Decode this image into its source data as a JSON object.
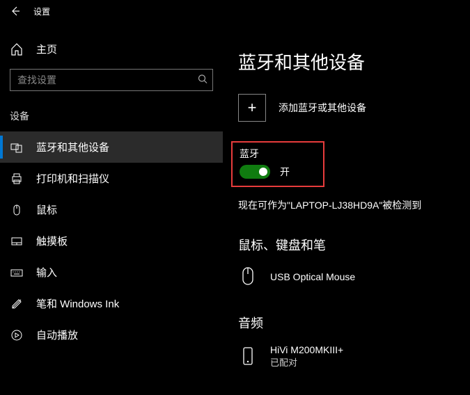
{
  "header": {
    "title": "设置"
  },
  "sidebar": {
    "home_label": "主页",
    "search_placeholder": "查找设置",
    "category_label": "设备",
    "items": [
      {
        "label": "蓝牙和其他设备"
      },
      {
        "label": "打印机和扫描仪"
      },
      {
        "label": "鼠标"
      },
      {
        "label": "触摸板"
      },
      {
        "label": "输入"
      },
      {
        "label": "笔和 Windows Ink"
      },
      {
        "label": "自动播放"
      }
    ]
  },
  "content": {
    "page_title": "蓝牙和其他设备",
    "add_label": "添加蓝牙或其他设备",
    "bluetooth": {
      "title": "蓝牙",
      "toggle_label": "开"
    },
    "status_text": "现在可作为\"LAPTOP-LJ38HD9A\"被检测到",
    "section_mouse": {
      "title": "鼠标、键盘和笔",
      "device_name": "USB Optical Mouse"
    },
    "section_audio": {
      "title": "音频",
      "device_name": "HiVi M200MKIII+",
      "device_status": "已配对"
    }
  }
}
